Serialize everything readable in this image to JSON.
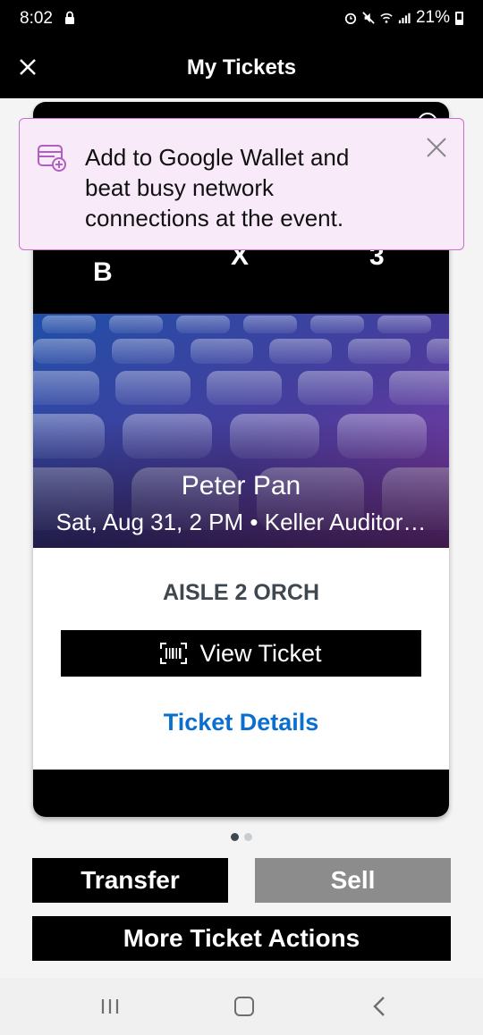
{
  "status_bar": {
    "time": "8:02",
    "battery": "21%",
    "icons": [
      "lock-icon",
      "alarm-icon",
      "mute-icon",
      "wifi-icon",
      "signal-icon",
      "battery-icon"
    ]
  },
  "header": {
    "title": "My Tickets",
    "close_icon": "close-icon"
  },
  "ticket": {
    "seat": {
      "section": "B",
      "row": "X",
      "seat": "3"
    },
    "event_name": "Peter Pan",
    "event_info": "Sat, Aug 31, 2 PM • Keller Auditor…",
    "section_label": "AISLE 2 ORCH",
    "view_ticket_label": "View Ticket",
    "ticket_details_label": "Ticket Details"
  },
  "wallet_banner": {
    "text": "Add to Google Wallet and beat busy network connections at the event."
  },
  "pager": {
    "total": 2,
    "active": 1
  },
  "actions": {
    "transfer_label": "Transfer",
    "sell_label": "Sell",
    "more_label": "More Ticket Actions"
  },
  "colors": {
    "header_bg": "#000000",
    "link": "#0a6fcf",
    "wallet_bg": "#f9eafa",
    "wallet_border": "#c76fcc",
    "sell_disabled": "#8c8c8c"
  }
}
